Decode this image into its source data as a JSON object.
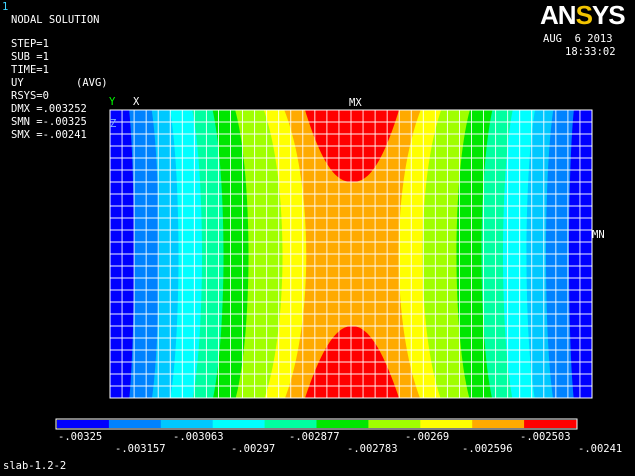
{
  "window_number": "1",
  "title": "NODAL SOLUTION",
  "info": {
    "step": "STEP=1",
    "sub": "SUB =1",
    "time": "TIME=1",
    "uy": "UY",
    "avg": "(AVG)",
    "rsys": "RSYS=0",
    "dmx": "DMX =.003252",
    "smn": "SMN =-.00325",
    "smx": "SMX =-.00241"
  },
  "logo": {
    "text_main": "AN",
    "text_s": "S",
    "text_ys": "YS"
  },
  "date": "AUG  6 2013",
  "time_stamp": "18:33:02",
  "triad": {
    "y": "Y",
    "x": "X",
    "z": "Z"
  },
  "markers": {
    "mx": "MX",
    "mn": "MN"
  },
  "legend": {
    "colors": [
      "#0000ff",
      "#0082ff",
      "#00c8ff",
      "#00ffff",
      "#00ffa0",
      "#00e600",
      "#a0ff00",
      "#ffff00",
      "#ffaa00",
      "#ff0000"
    ],
    "labels_top": [
      "-.00325",
      "-.003063",
      "-.002877",
      "-.00269",
      "-.002503"
    ],
    "labels_bottom": [
      "-.003157",
      "-.00297",
      "-.002783",
      "-.002596",
      "-.00241"
    ]
  },
  "file_label": "slab-1.2-2"
}
